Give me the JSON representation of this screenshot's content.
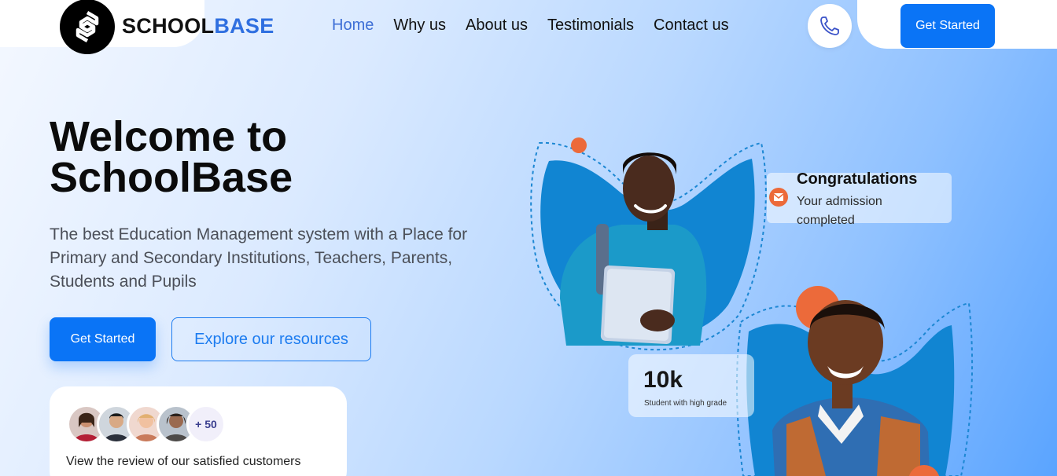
{
  "brand": {
    "name_part1": "SCHOOL",
    "name_part2": "BASE",
    "logo_icon": "schoolbase-logo-icon"
  },
  "nav": {
    "items": [
      {
        "label": "Home",
        "active": true
      },
      {
        "label": "Why us",
        "active": false
      },
      {
        "label": "About us",
        "active": false
      },
      {
        "label": "Testimonials",
        "active": false
      },
      {
        "label": "Contact us",
        "active": false
      }
    ],
    "phone_icon": "phone-icon",
    "cta_label": "Get Started"
  },
  "hero": {
    "title": "Welcome to SchoolBase",
    "subtitle": "The best Education Management system with a Place for Primary and Secondary Institutions, Teachers, Parents, Students and Pupils",
    "primary_button": "Get Started",
    "secondary_button": "Explore our resources"
  },
  "reviews": {
    "count_label": "+ 50",
    "text": "View the review of our satisfied customers"
  },
  "congrats_card": {
    "title": "Congratulations",
    "subtitle": "Your admission completed",
    "icon": "mail-icon"
  },
  "stat_card": {
    "value": "10k",
    "label": "Student with high grade"
  },
  "colors": {
    "primary": "#0a74f6",
    "brand_accent": "#2f6fe0",
    "nav_active": "#3e6fd6",
    "orange_accent": "#ec6a3a",
    "blob_blue": "#1c87d3"
  }
}
